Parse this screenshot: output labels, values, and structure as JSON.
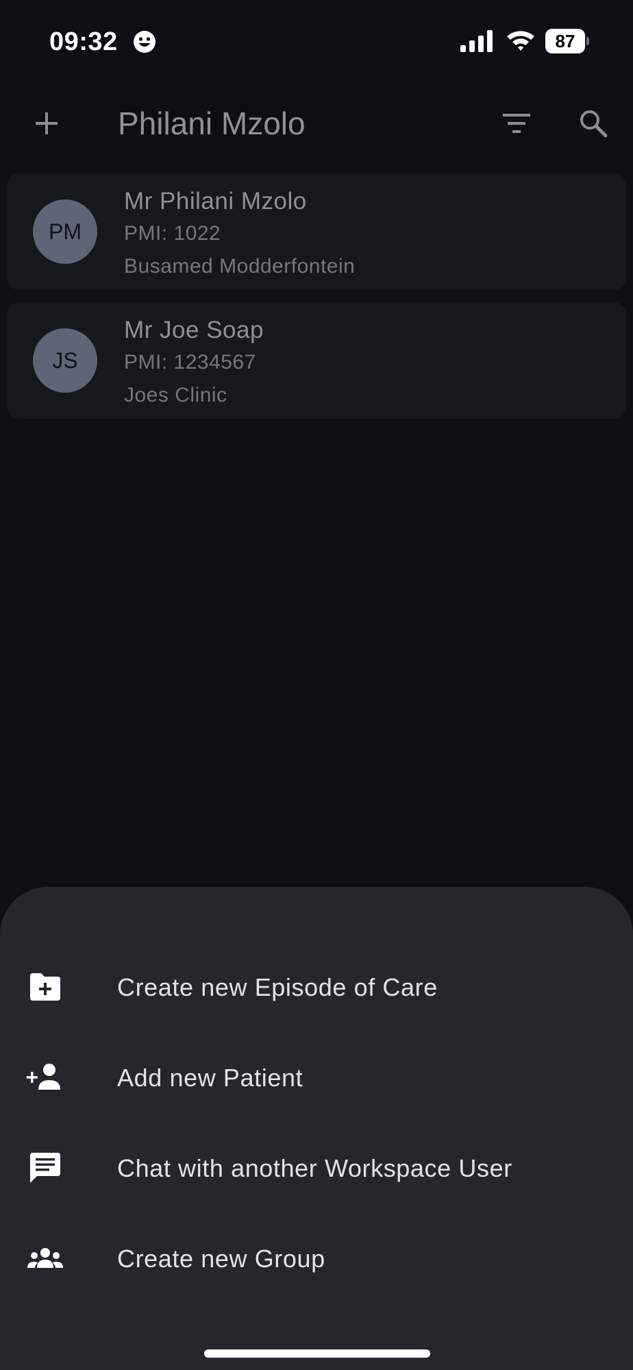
{
  "status_bar": {
    "time": "09:32",
    "battery_level": "87",
    "icons": [
      "smiley-face-icon",
      "cellular-signal-icon",
      "wifi-icon",
      "battery-icon"
    ]
  },
  "app_bar": {
    "title": "Philani Mzolo",
    "icons": [
      "add-icon",
      "filter-icon",
      "search-icon"
    ]
  },
  "patients": [
    {
      "initials": "PM",
      "name": "Mr Philani Mzolo",
      "pmi": "PMI: 1022",
      "clinic": "Busamed Modderfontein"
    },
    {
      "initials": "JS",
      "name": "Mr Joe Soap",
      "pmi": "PMI: 1234567",
      "clinic": "Joes Clinic"
    }
  ],
  "bottom_sheet": {
    "items": [
      {
        "label": "Create new Episode of Care",
        "icon": "folder-add-icon"
      },
      {
        "label": "Add new Patient",
        "icon": "person-add-icon"
      },
      {
        "label": "Chat with another Workspace User",
        "icon": "chat-icon"
      },
      {
        "label": "Create new Group",
        "icon": "group-icon"
      }
    ]
  },
  "colors": {
    "background": "#0e0f12",
    "card": "#17181c",
    "avatar": "#5d6577",
    "sheet": "#26272c",
    "sheet_text": "#e4e4e8"
  }
}
